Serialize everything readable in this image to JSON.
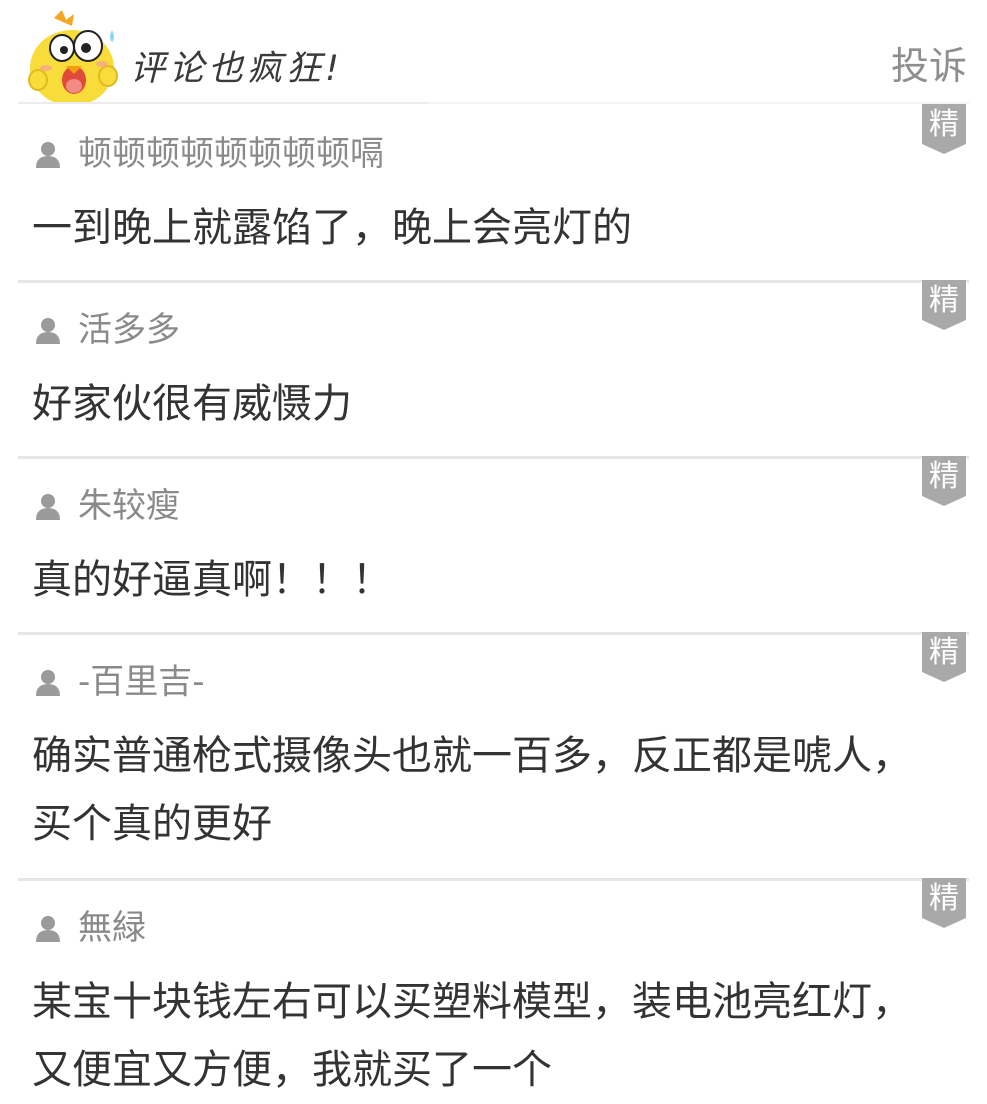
{
  "header": {
    "title": "评论也疯狂!",
    "report_label": "投诉"
  },
  "badge_label": "精",
  "comments": [
    {
      "username": "顿顿顿顿顿顿顿顿嗝",
      "text": "一到晚上就露馅了，晚上会亮灯的"
    },
    {
      "username": "活多多",
      "text": "好家伙很有威慑力"
    },
    {
      "username": "朱较瘦",
      "text": "真的好逼真啊！！！"
    },
    {
      "username": "-百里吉-",
      "text": "确实普通枪式摄像头也就一百多，反正都是唬人，买个真的更好"
    },
    {
      "username": "無緑",
      "text": "某宝十块钱左右可以买塑料模型，装电池亮红灯，又便宜又方便，我就买了一个"
    }
  ],
  "colors": {
    "badge": "#a9a9a9",
    "username": "#8a8a8a",
    "text": "#333333",
    "report": "#8e8e8e",
    "mascot": "#f7dc3a"
  },
  "icons": {
    "user": "user-icon",
    "mascot": "chick-mascot-icon"
  }
}
